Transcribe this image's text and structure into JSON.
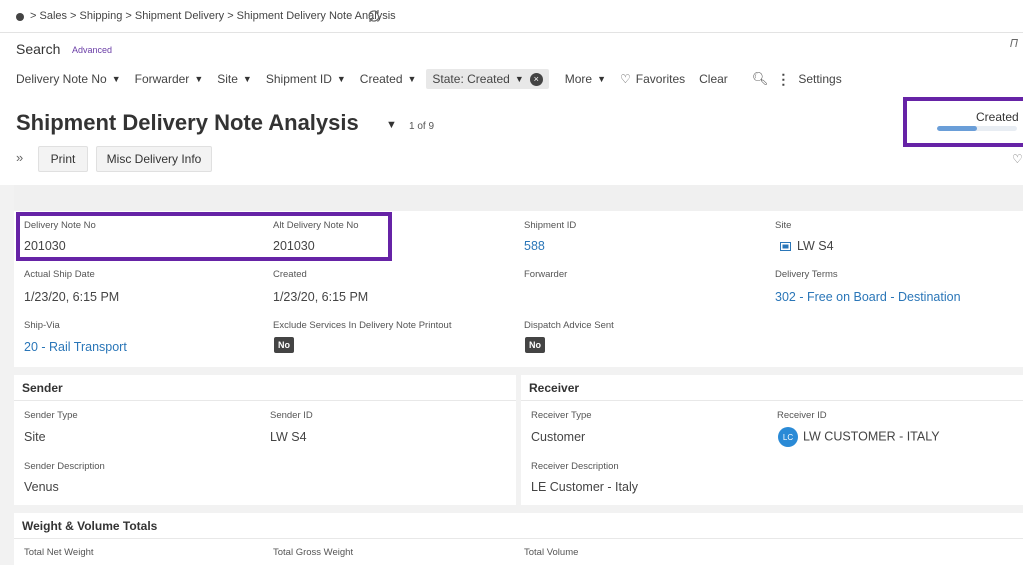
{
  "breadcrumb": {
    "path": "Sales > Shipping > Shipment Delivery > Shipment Delivery Note Analysis"
  },
  "search": {
    "label": "Search",
    "advanced": "Advanced",
    "pin": "ᨙ"
  },
  "filters": [
    {
      "label": "Delivery Note No",
      "caret": "▼"
    },
    {
      "label": "Forwarder",
      "caret": "▼"
    },
    {
      "label": "Site",
      "caret": "▼"
    },
    {
      "label": "Shipment ID",
      "caret": "▼"
    },
    {
      "label": "Created",
      "caret": "▼"
    }
  ],
  "active_filter": {
    "label": "State: Created",
    "caret": "▼",
    "clear": "×"
  },
  "toolbar": {
    "more": "More",
    "more_caret": "▼",
    "favorites": "Favorites",
    "clear": "Clear",
    "settings": "Settings"
  },
  "page": {
    "title": "Shipment Delivery Note Analysis",
    "counter": "1 of 9",
    "status": "Created",
    "status_progress": 0.5,
    "print_label": "Print",
    "misc_label": "Misc Delivery Info"
  },
  "details": {
    "delivery_note_no_label": "Delivery Note No",
    "delivery_note_no": "201030",
    "alt_delivery_note_no_label": "Alt Delivery Note No",
    "alt_delivery_note_no": "201030",
    "shipment_id_label": "Shipment ID",
    "shipment_id": "588",
    "site_label": "Site",
    "site": "LW S4",
    "actual_ship_date_label": "Actual Ship Date",
    "actual_ship_date": "1/23/20, 6:15 PM",
    "created_label": "Created",
    "created": "1/23/20, 6:15 PM",
    "forwarder_label": "Forwarder",
    "delivery_terms_label": "Delivery Terms",
    "delivery_terms": "302 - Free on Board - Destination",
    "ship_via_label": "Ship-Via",
    "ship_via": "20 - Rail Transport",
    "exclude_services_label": "Exclude Services In Delivery Note Printout",
    "exclude_services": "No",
    "dispatch_advice_label": "Dispatch Advice Sent",
    "dispatch_advice": "No"
  },
  "sender": {
    "heading": "Sender",
    "type_label": "Sender Type",
    "type": "Site",
    "id_label": "Sender ID",
    "id": "LW S4",
    "description_label": "Sender Description",
    "description": "Venus"
  },
  "receiver": {
    "heading": "Receiver",
    "type_label": "Receiver Type",
    "type": "Customer",
    "id_label": "Receiver ID",
    "avatar": "LC",
    "id": "LW CUSTOMER - ITALY",
    "description_label": "Receiver Description",
    "description": "LE Customer - Italy"
  },
  "weights": {
    "heading": "Weight & Volume Totals",
    "net_weight_label": "Total Net Weight",
    "gross_weight_label": "Total Gross Weight",
    "volume_label": "Total Volume"
  },
  "colors": {
    "highlight": "#6623a6",
    "link": "#2a76b8",
    "progress": "#6a9ed8"
  }
}
